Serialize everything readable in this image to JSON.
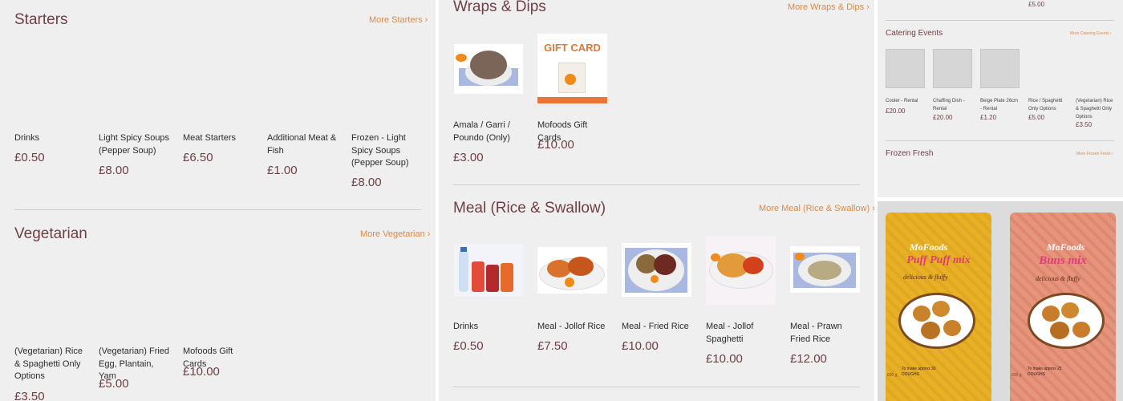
{
  "starters": {
    "title": "Starters",
    "more": "More Starters ›",
    "items": [
      {
        "name": "Drinks",
        "price": "£0.50"
      },
      {
        "name": "Light Spicy Soups (Pepper Soup)",
        "price": "£8.00"
      },
      {
        "name": "Meat Starters",
        "price": "£6.50"
      },
      {
        "name": "Additional Meat & Fish",
        "price": "£1.00"
      },
      {
        "name": "Frozen - Light Spicy Soups (Pepper Soup)",
        "price": "£8.00"
      }
    ]
  },
  "vegetarian": {
    "title": "Vegetarian",
    "more": "More Vegetarian ›",
    "items": [
      {
        "name": "(Vegetarian) Rice & Spaghetti Only Options",
        "price": "£3.50"
      },
      {
        "name": "(Vegetarian) Fried Egg, Plantain, Yam",
        "price": "£5.00"
      },
      {
        "name": "Mofoods Gift Cards",
        "price": "£10.00"
      }
    ]
  },
  "wraps": {
    "title": "Wraps & Dips",
    "more": "More Wraps & Dips ›",
    "gift_card_text": "GIFT CARD",
    "items": [
      {
        "name": "Amala / Garri / Poundo (Only)",
        "price": "£3.00"
      },
      {
        "name": "Mofoods Gift Cards",
        "price": "£10.00"
      }
    ]
  },
  "meal": {
    "title": "Meal (Rice & Swallow)",
    "more": "More Meal (Rice & Swallow) ›",
    "items": [
      {
        "name": "Drinks",
        "price": "£0.50"
      },
      {
        "name": "Meal - Jollof Rice",
        "price": "£7.50"
      },
      {
        "name": "Meal - Fried Rice",
        "price": "£10.00"
      },
      {
        "name": "Meal - Jollof Spaghetti",
        "price": "£10.00"
      },
      {
        "name": "Meal - Prawn Fried Rice",
        "price": "£12.00"
      }
    ]
  },
  "catering": {
    "top_price": "£5.00",
    "title": "Catering Events",
    "more": "More Catering Events ›",
    "items": [
      {
        "name": "Cooler - Rental",
        "price": "£20.00"
      },
      {
        "name": "Chaffing Dish - Rental",
        "price": "£20.00"
      },
      {
        "name": "Beige Plate 26cm - Rental",
        "price": "£1.20"
      },
      {
        "name": "Rice / Spaghetti Only Options",
        "price": "£5.00"
      },
      {
        "name": "(Vegetarian) Rice & Spaghetti Only Options",
        "price": "£3.50"
      }
    ]
  },
  "frozen": {
    "title": "Frozen Fresh",
    "more": "More Frozen Fresh ›"
  },
  "packaging": {
    "pouch1": {
      "brand": "MoFoods",
      "product": "Puff Puff mix",
      "tagline": "delicious & fluffy",
      "note": "To make approx 30 DOUGHS",
      "weight": "600 g"
    },
    "pouch2": {
      "brand": "MoFoods",
      "product": "Buns mix",
      "tagline": "delicious & fluffy",
      "note": "To make approx 25 DOUGHS",
      "weight": "600 g"
    }
  },
  "colors": {
    "title": "#6e3f44",
    "link": "#d68b4a",
    "panel": "#efefef",
    "pouch1": "#e8b024",
    "pouch2": "#e7947d"
  }
}
